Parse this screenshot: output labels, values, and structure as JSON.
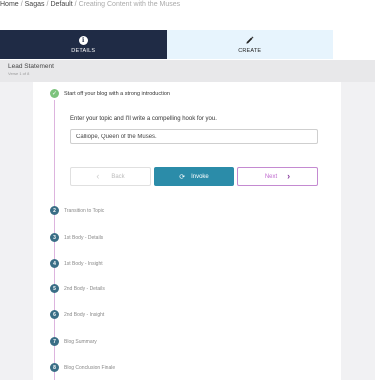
{
  "breadcrumb": {
    "items": [
      "Home",
      "Sagas",
      "Default",
      "Creating Content with the Muses"
    ],
    "separator": "/"
  },
  "tabs": [
    {
      "label": "DETAILS",
      "icon": "info-icon",
      "icon_glyph": "i",
      "active": true
    },
    {
      "label": "CREATE",
      "icon": "pencil-icon",
      "active": false
    }
  ],
  "section": {
    "title": "Lead Statement",
    "subtitle": "Verse 1 of 8"
  },
  "current_step": {
    "label": "Start off your blog with a strong introduction",
    "prompt": "Enter your topic and I'll write a compelling hook for you.",
    "input_value": "Calliope, Queen of the Muses."
  },
  "buttons": {
    "back": "Back",
    "invoke": "Invoke",
    "next": "Next"
  },
  "steps": [
    {
      "num": "2",
      "label": "Transition to Topic"
    },
    {
      "num": "3",
      "label": "1st Body - Details"
    },
    {
      "num": "4",
      "label": "1st Body - Insight"
    },
    {
      "num": "5",
      "label": "2nd Body - Details"
    },
    {
      "num": "6",
      "label": "2nd Body - Insight"
    },
    {
      "num": "7",
      "label": "Blog Summary"
    },
    {
      "num": "8",
      "label": "Blog Conclusion Finale"
    }
  ],
  "colors": {
    "nav_dark": "#1f2b45",
    "create_tab_bg": "#e7f4fd",
    "invoke_button": "#2b8ca9",
    "next_accent": "#c06bcf",
    "step_done": "#7cc37c",
    "step_pending": "#3a6e86",
    "timeline": "#ddb4de"
  }
}
